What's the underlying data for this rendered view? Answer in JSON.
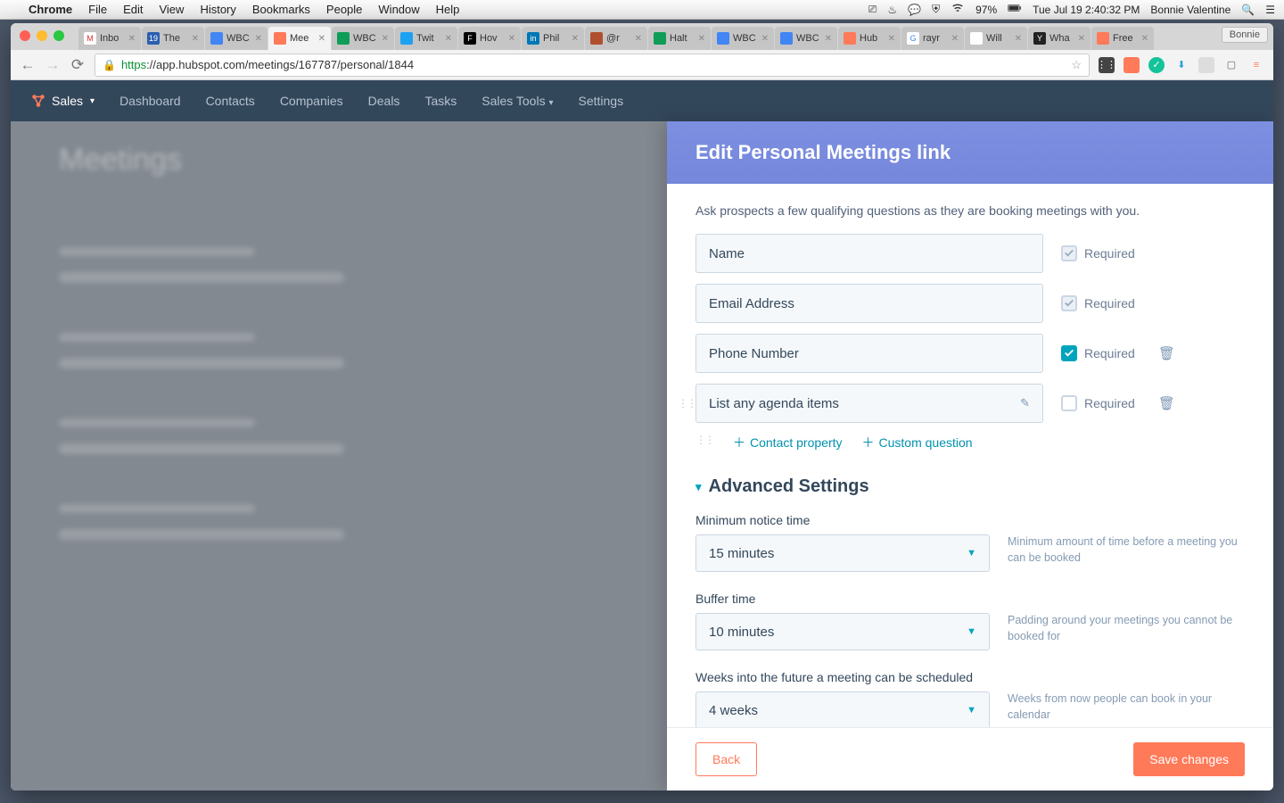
{
  "menubar": {
    "app": "Chrome",
    "items": [
      "File",
      "Edit",
      "View",
      "History",
      "Bookmarks",
      "People",
      "Window",
      "Help"
    ],
    "battery": "97%",
    "datetime": "Tue Jul 19  2:40:32 PM",
    "user": "Bonnie Valentine"
  },
  "chrome": {
    "user_chip": "Bonnie",
    "url": {
      "scheme": "https",
      "rest": "://app.hubspot.com/meetings/167787/personal/1844"
    },
    "tabs": [
      {
        "label": "Inbo",
        "fav_bg": "#fff",
        "fav_txt": "M",
        "fav_color": "#d33"
      },
      {
        "label": "The",
        "fav_bg": "#2b5fb0",
        "fav_txt": "19",
        "fav_color": "#fff"
      },
      {
        "label": "WBC",
        "fav_bg": "#4285f4",
        "fav_txt": "",
        "fav_color": "#fff"
      },
      {
        "label": "Mee",
        "fav_bg": "#ff7a59",
        "fav_txt": "",
        "fav_color": "#fff",
        "active": true
      },
      {
        "label": "WBC",
        "fav_bg": "#0f9d58",
        "fav_txt": "",
        "fav_color": "#fff"
      },
      {
        "label": "Twit",
        "fav_bg": "#1da1f2",
        "fav_txt": "",
        "fav_color": "#fff"
      },
      {
        "label": "Hov",
        "fav_bg": "#000",
        "fav_txt": "F",
        "fav_color": "#fff"
      },
      {
        "label": "Phil",
        "fav_bg": "#0077b5",
        "fav_txt": "in",
        "fav_color": "#fff"
      },
      {
        "label": "@r",
        "fav_bg": "#b04f2e",
        "fav_txt": "",
        "fav_color": "#fff"
      },
      {
        "label": "Halt",
        "fav_bg": "#0f9d58",
        "fav_txt": "",
        "fav_color": "#fff"
      },
      {
        "label": "WBC",
        "fav_bg": "#4285f4",
        "fav_txt": "",
        "fav_color": "#fff"
      },
      {
        "label": "WBC",
        "fav_bg": "#4285f4",
        "fav_txt": "",
        "fav_color": "#fff"
      },
      {
        "label": "Hub",
        "fav_bg": "#ff7a59",
        "fav_txt": "",
        "fav_color": "#fff"
      },
      {
        "label": "rayr",
        "fav_bg": "#fff",
        "fav_txt": "G",
        "fav_color": "#4285f4"
      },
      {
        "label": "Will",
        "fav_bg": "#fff",
        "fav_txt": "",
        "fav_color": "#333"
      },
      {
        "label": "Wha",
        "fav_bg": "#222",
        "fav_txt": "Y",
        "fav_color": "#fff"
      },
      {
        "label": "Free",
        "fav_bg": "#ff7a59",
        "fav_txt": "",
        "fav_color": "#fff"
      }
    ]
  },
  "hsnav": {
    "brand": "Sales",
    "items": [
      "Dashboard",
      "Contacts",
      "Companies",
      "Deals",
      "Tasks",
      "Sales Tools",
      "Settings"
    ]
  },
  "background_page": {
    "title": "Meetings"
  },
  "panel": {
    "title": "Edit Personal Meetings link",
    "description": "Ask prospects a few qualifying questions as they are booking meetings with you.",
    "fields": [
      {
        "label": "Name",
        "required": true,
        "locked": true,
        "editable": false,
        "deletable": false
      },
      {
        "label": "Email Address",
        "required": true,
        "locked": true,
        "editable": false,
        "deletable": false
      },
      {
        "label": "Phone Number",
        "required": true,
        "locked": false,
        "editable": false,
        "deletable": true
      },
      {
        "label": "List any agenda items",
        "required": false,
        "locked": false,
        "editable": true,
        "deletable": true
      }
    ],
    "required_label": "Required",
    "add_links": {
      "contact": "Contact property",
      "custom": "Custom question"
    },
    "advanced_title": "Advanced Settings",
    "settings": [
      {
        "label": "Minimum notice time",
        "value": "15 minutes",
        "help": "Minimum amount of time before a meeting you can be booked"
      },
      {
        "label": "Buffer time",
        "value": "10 minutes",
        "help": "Padding around your meetings you cannot be booked for"
      },
      {
        "label": "Weeks into the future a meeting can be scheduled",
        "value": "4 weeks",
        "help": "Weeks from now people can book in your calendar"
      }
    ],
    "back": "Back",
    "save": "Save changes"
  }
}
